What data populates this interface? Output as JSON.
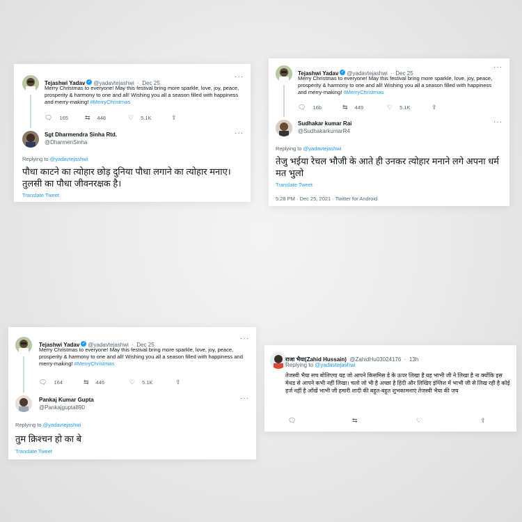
{
  "tweet": {
    "author": "Tejashwi Yadav",
    "handle_1": "@yadavtejashwi",
    "handle_2": "@yadavtejashwi",
    "handle_3": "@yadavtejashwi",
    "date": "Dec 25",
    "dot": "·",
    "more": "···",
    "hashtag": "#MerryChristmas",
    "text_1": "Merry Christmas to everyone! May this festival bring more sparkle, love, joy, peace, prosperity & harmony to one and all! Wishing you all a season filled with happiness and merry-making!",
    "text_2": "Merry Christmas to everyone! May this festival bring more sparkle, love, joy, peace, prosperity & harmony to one and all! Wishing you all a season filled with happiness and merry-making!",
    "text_3": "Merry Christmas to everyone! May this festival bring more sparkle, love, joy, peace, prosperity & harmony to one and all! Wishing you all a season filled with happiness and merry-making!"
  },
  "icons": {
    "reply": "reply-icon",
    "retweet": "retweet-icon",
    "like": "heart-icon",
    "share": "share-icon",
    "verified": "verified-badge-icon",
    "more": "more-icon"
  },
  "colors": {
    "link": "#1d9bf0",
    "muted": "#536471",
    "text": "#0f1419"
  },
  "card1": {
    "stats": {
      "replies": "165",
      "retweets": "448",
      "likes": "5.1K"
    },
    "reply_author": "Sgt Dharmendra Sinha Rtd.",
    "reply_handle": "@DharmenSinha",
    "replying_label": "Replying to",
    "replying_handle": "@yadavtejashwi",
    "reply_text": "पौधा काटने का त्योहार छोड़ दुनिया पौधा लगाने का त्योहार मनाए। तुलसी का पौधा जीवनरक्षक है।",
    "translate": "Translate Tweet"
  },
  "card2": {
    "stats": {
      "replies": "16b",
      "retweets": "449",
      "likes": "5.1K"
    },
    "reply_author": "Sudhakar kumar Rai",
    "reply_handle": "@SudhakarkumarR4",
    "replying_label": "Replying to",
    "replying_handle": "@yadavtejashwi",
    "reply_text": "तेजु भईया रेचल भौजी के आते ही उनकर त्योहार मनाने लगे अपना धर्म मत भुलो",
    "translate": "Translate Tweet",
    "footer": "5:28 PM · Dec 25, 2021 · Twitter for Android"
  },
  "card3": {
    "stats": {
      "replies": "164",
      "retweets": "446",
      "likes": "5.1K"
    },
    "reply_author": "Pankaj Kumar Gupta",
    "reply_handle": "@Pankajgupta890",
    "replying_label": "Replying to",
    "replying_handle": "@yadavtejashwi",
    "reply_text": "तुम क्रिश्चन हो का बे",
    "translate": "Translate Tweet"
  },
  "card4": {
    "author": "राजा भैया(Zahid Hussain)",
    "handle": "@ZahidHu03024176",
    "time": "13h",
    "replying_label": "Replying to",
    "replying_handle": "@yadavtejashwi",
    "reply_text": "तेजस्वी भैया सच बोलिएगा यह जो आपने किसमिस डे के ऊपर लिखा है यह भाभी जी ने लिखा है ना क्योंकि इस मेथड से आपने कभी नहीं लिखा। चलो जो भी है अच्छा है हिंदी और लिखिए इंग्लिश में भाभी जी से लिख रही है कोई हर्ज नहीं है आँखें भाभी जी हमारी शादी की बहुत-बहुत शुभकामनाएं तेजस्वी भैया की जय"
  }
}
